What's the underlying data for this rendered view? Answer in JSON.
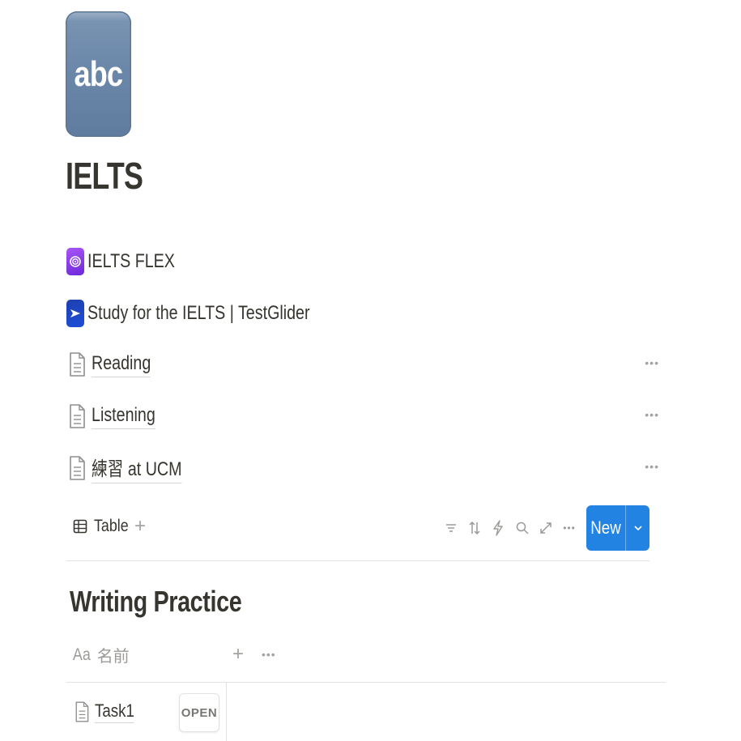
{
  "page": {
    "icon_text": "abc",
    "title": "IELTS"
  },
  "links": [
    {
      "label": "IELTS FLEX",
      "icon": "ielts-flex-app-icon"
    },
    {
      "label": "Study for the IELTS | TestGlider",
      "icon": "testglider-app-icon"
    }
  ],
  "subpages": [
    {
      "label": "Reading",
      "icon": "document-icon"
    },
    {
      "label": "Listening",
      "icon": "document-icon"
    },
    {
      "label": "練習 at UCM",
      "icon": "document-icon"
    }
  ],
  "more_glyph": "•••",
  "database": {
    "view_label": "Table",
    "add_view_glyph": "+",
    "new_button_label": "New",
    "title": "Writing Practice",
    "columns": [
      {
        "type_glyph": "Aa",
        "name": "名前"
      }
    ],
    "add_column_glyph": "+",
    "rows": [
      {
        "name": "Task1",
        "open_label": "OPEN"
      }
    ]
  },
  "colors": {
    "accent": "#2383e2",
    "text": "#37352f",
    "muted": "#9b9a97",
    "icon_bg": "#6a86a8"
  }
}
